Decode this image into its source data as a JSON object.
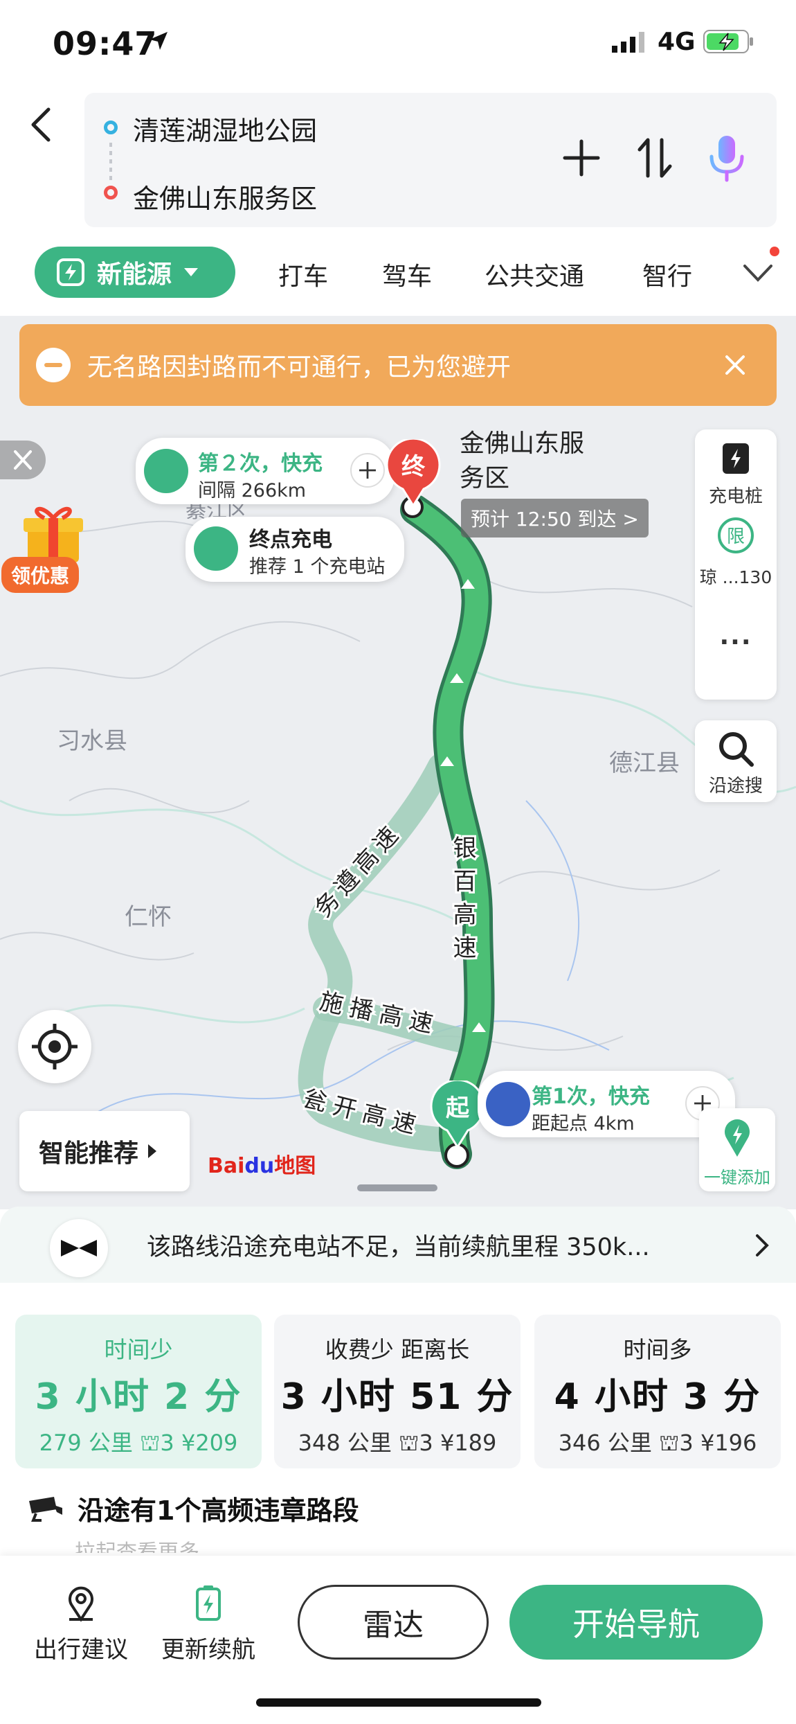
{
  "status_bar": {
    "time": "09:47",
    "network": "4G"
  },
  "header": {
    "start_place": "清莲湖湿地公园",
    "end_place": "金佛山东服务区"
  },
  "modes": {
    "active": "新能源",
    "items": [
      "打车",
      "驾车",
      "公共交通",
      "智行"
    ]
  },
  "map": {
    "alert_text": "无名路因封路而不可通行，已为您避开",
    "promo_label": "领优惠",
    "place_labels": [
      "习水县",
      "仁怀",
      "德江县",
      "綦江区"
    ],
    "road_labels": [
      "银百高速",
      "务遵高速",
      "施播高速",
      "瓮开高速"
    ],
    "charge2": {
      "title": "第２次，快充",
      "sub": "间隔 266km"
    },
    "end_charge": {
      "title": "终点充电",
      "sub": "推荐 1 个充电站"
    },
    "end_pin": "终",
    "start_pin": "起",
    "dest_name": "金佛山东服务区",
    "eta": "预计 12:50 到达 >",
    "charge1": {
      "title": "第1次，快充",
      "sub": "距起点 4km"
    },
    "side_charger": "充电桩",
    "side_limit": "琼 ...130",
    "side_more": "...",
    "side_search": "沿途搜",
    "smart_label": "智能推荐",
    "baidu_logo": {
      "a": "Bai",
      "b": "du",
      "c": "地图"
    },
    "one_add": "一键添加"
  },
  "sheet": {
    "notice": "该路线沿途充电站不足，当前续航里程 350k...",
    "routes": [
      {
        "tag": "时间少",
        "duration": "3 小时 2 分",
        "meta": "279 公里  ⛫3 ¥209",
        "selected": true
      },
      {
        "tag": "收费少  距离长",
        "duration": "3 小时 51 分",
        "meta": "348 公里  ⛫3 ¥189",
        "selected": false
      },
      {
        "tag": "时间多",
        "duration": "4 小时 3 分",
        "meta": "346 公里  ⛫3 ¥196",
        "selected": false
      }
    ],
    "violation": "沿途有1个高频违章路段",
    "hint": "拉起查看更多",
    "bottom": {
      "advice": "出行建议",
      "update_range": "更新续航",
      "radar": "雷达",
      "start_nav": "开始导航"
    }
  },
  "colors": {
    "accent": "#3cb584",
    "alert": "#f1a95a",
    "end_pin": "#e9473f"
  }
}
